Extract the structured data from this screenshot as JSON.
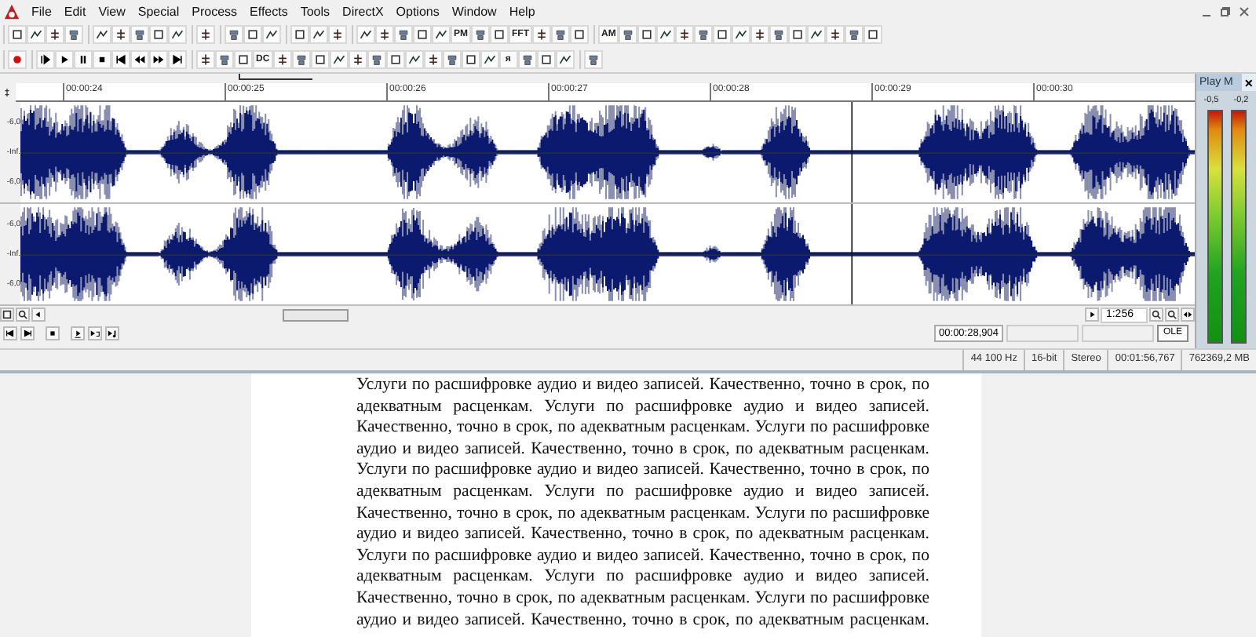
{
  "menu": [
    "File",
    "Edit",
    "View",
    "Special",
    "Process",
    "Effects",
    "Tools",
    "DirectX",
    "Options",
    "Window",
    "Help"
  ],
  "toolbar_rows": [
    [
      [
        {
          "kind": "icon"
        },
        {
          "kind": "icon"
        },
        {
          "kind": "icon"
        },
        {
          "kind": "icon"
        }
      ],
      [
        {
          "kind": "icon"
        },
        {
          "kind": "icon"
        },
        {
          "kind": "icon"
        },
        {
          "kind": "icon"
        },
        {
          "kind": "icon"
        }
      ],
      [
        {
          "kind": "icon"
        }
      ],
      [
        {
          "kind": "icon"
        },
        {
          "kind": "icon"
        },
        {
          "kind": "icon"
        }
      ],
      [
        {
          "kind": "icon"
        },
        {
          "kind": "icon"
        },
        {
          "kind": "icon"
        }
      ],
      [
        {
          "kind": "icon"
        },
        {
          "kind": "icon"
        },
        {
          "kind": "icon"
        },
        {
          "kind": "icon"
        },
        {
          "kind": "icon"
        },
        {
          "kind": "text",
          "label": "PM"
        },
        {
          "kind": "icon"
        },
        {
          "kind": "icon"
        },
        {
          "kind": "text",
          "label": "FFT"
        },
        {
          "kind": "icon"
        },
        {
          "kind": "icon"
        },
        {
          "kind": "icon"
        }
      ],
      [
        {
          "kind": "text",
          "label": "AM"
        },
        {
          "kind": "icon"
        },
        {
          "kind": "icon"
        },
        {
          "kind": "icon"
        },
        {
          "kind": "icon"
        },
        {
          "kind": "icon"
        },
        {
          "kind": "icon"
        },
        {
          "kind": "icon"
        },
        {
          "kind": "icon"
        },
        {
          "kind": "icon"
        },
        {
          "kind": "icon"
        },
        {
          "kind": "icon"
        },
        {
          "kind": "icon"
        },
        {
          "kind": "icon"
        },
        {
          "kind": "icon"
        }
      ]
    ],
    [
      [
        {
          "kind": "record"
        }
      ],
      [
        {
          "kind": "play-sel"
        },
        {
          "kind": "play"
        },
        {
          "kind": "pause"
        },
        {
          "kind": "stop"
        },
        {
          "kind": "start"
        },
        {
          "kind": "rewind"
        },
        {
          "kind": "forward"
        },
        {
          "kind": "end"
        }
      ],
      [
        {
          "kind": "icon"
        },
        {
          "kind": "icon"
        },
        {
          "kind": "icon"
        },
        {
          "kind": "text",
          "label": "DC"
        },
        {
          "kind": "icon"
        },
        {
          "kind": "icon"
        },
        {
          "kind": "icon"
        },
        {
          "kind": "icon"
        },
        {
          "kind": "icon"
        },
        {
          "kind": "icon"
        },
        {
          "kind": "icon"
        },
        {
          "kind": "icon"
        },
        {
          "kind": "icon"
        },
        {
          "kind": "icon"
        },
        {
          "kind": "icon"
        },
        {
          "kind": "icon"
        },
        {
          "kind": "text",
          "label": "я"
        },
        {
          "kind": "icon"
        },
        {
          "kind": "icon"
        },
        {
          "kind": "icon"
        }
      ],
      [
        {
          "kind": "icon"
        }
      ]
    ]
  ],
  "ruler": [
    "00:00:24",
    "00:00:25",
    "00:00:26",
    "00:00:27",
    "00:00:28",
    "00:00:29",
    "00:00:30"
  ],
  "channels": [
    {
      "scale": [
        "-6,0",
        "-Inf.",
        "-6,0"
      ]
    },
    {
      "scale": [
        "-6,0",
        "-Inf.",
        "-6,0"
      ]
    }
  ],
  "zoom_ratio": "1:256",
  "cursor_time": "00:00:28,904",
  "ole_button": "OLE",
  "status_bar": [
    "44 100 Hz",
    "16-bit",
    "Stereo",
    "00:01:56,767",
    "762369,2 MB"
  ],
  "meter": {
    "title": "Play M",
    "close": "×",
    "channels": [
      {
        "reading": "-0,5",
        "level": 1
      },
      {
        "reading": "-0,2",
        "level": 1
      }
    ]
  },
  "document": {
    "lines": [
      "Услуги по расшифровке аудио и видео записей. Качественно, точно в срок, по",
      "адекватным расценкам. Услуги по расшифровке аудио и видео записей.",
      "Качественно, точно в срок, по адекватным расценкам. Услуги по расшифровке",
      "аудио и видео записей. Качественно, точно в срок, по адекватным расценкам.",
      "Услуги по расшифровке аудио и видео записей. Качественно, точно в срок, по",
      "адекватным расценкам. Услуги по расшифровке аудио и видео записей.",
      "Качественно, точно в срок, по адекватным расценкам. Услуги по расшифровке",
      "аудио и видео записей. Качественно, точно в срок, по адекватным расценкам.",
      "Услуги по расшифровке аудио и видео записей. Качественно, точно в срок, по",
      "адекватным расценкам. Услуги по расшифровке аудио и видео записей.",
      "Качественно, точно в срок, по адекватным расценкам. Услуги по расшифровке",
      "аудио и видео записей. Качественно, точно в срок, по адекватным расценкам."
    ]
  }
}
